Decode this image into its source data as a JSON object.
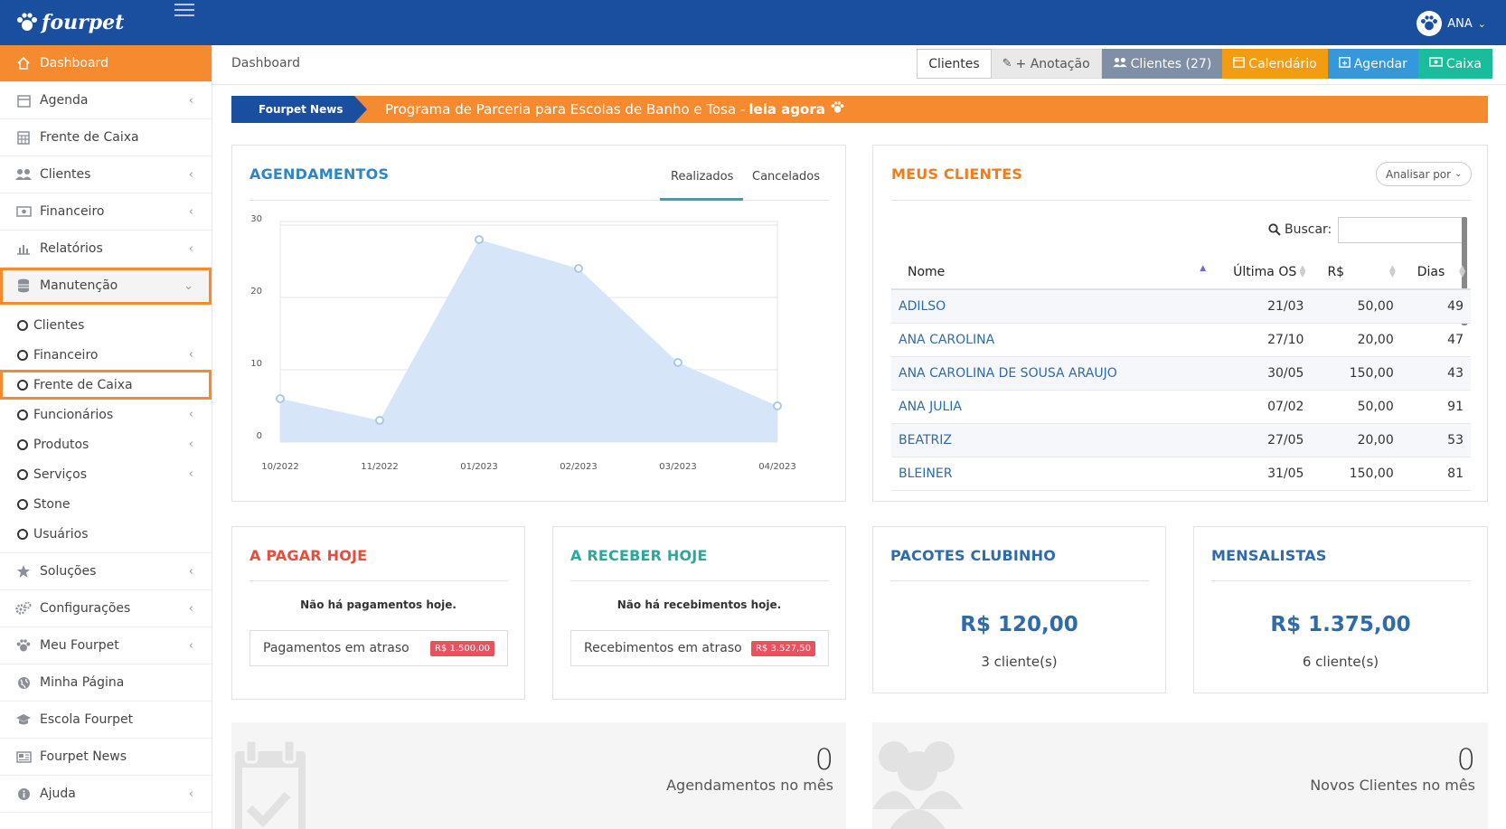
{
  "app": {
    "logo_text": "fourpet",
    "user_name": "ANA"
  },
  "sidebar": {
    "items": [
      {
        "label": "Dashboard",
        "icon": "home-icon"
      },
      {
        "label": "Agenda",
        "icon": "calendar-icon"
      },
      {
        "label": "Frente de Caixa",
        "icon": "calculator-icon"
      },
      {
        "label": "Clientes",
        "icon": "users-icon"
      },
      {
        "label": "Financeiro",
        "icon": "money-icon"
      },
      {
        "label": "Relatórios",
        "icon": "bar-chart-icon"
      },
      {
        "label": "Manutenção",
        "icon": "database-icon"
      }
    ],
    "sub_items": [
      {
        "label": "Clientes"
      },
      {
        "label": "Financeiro"
      },
      {
        "label": "Frente de Caixa"
      },
      {
        "label": "Funcionários"
      },
      {
        "label": "Produtos"
      },
      {
        "label": "Serviços"
      },
      {
        "label": "Stone"
      },
      {
        "label": "Usuários"
      }
    ],
    "items_after": [
      {
        "label": "Soluções",
        "icon": "star-icon"
      },
      {
        "label": "Configurações",
        "icon": "gears-icon"
      },
      {
        "label": "Meu Fourpet",
        "icon": "paw-icon"
      },
      {
        "label": "Minha Página",
        "icon": "globe-icon"
      },
      {
        "label": "Escola Fourpet",
        "icon": "graduation-cap-icon"
      },
      {
        "label": "Fourpet News",
        "icon": "newspaper-icon"
      },
      {
        "label": "Ajuda",
        "icon": "info-icon"
      }
    ]
  },
  "header": {
    "breadcrumb": "Dashboard",
    "buttons": {
      "clientes": "Clientes",
      "anotacao": "+ Anotação",
      "clientes27": "Clientes (27)",
      "calendario": "Calendário",
      "agendar": "Agendar",
      "caixa": "Caixa"
    }
  },
  "news": {
    "label": "Fourpet News",
    "text": "Programa de Parceria para Escolas de Banho e Tosa -",
    "link": "leia agora"
  },
  "agendamentos": {
    "title": "AGENDAMENTOS",
    "tab_active": "Realizados",
    "tab_other": "Cancelados"
  },
  "chart_data": {
    "type": "area",
    "x": [
      "10/2022",
      "11/2022",
      "01/2023",
      "02/2023",
      "03/2023",
      "04/2023"
    ],
    "series": [
      {
        "values": [
          6,
          3,
          28,
          24,
          11,
          5
        ]
      }
    ],
    "ylim": [
      0,
      30
    ],
    "yticks": [
      0,
      10,
      20,
      30
    ],
    "grid": true,
    "color": "#d6e6f8"
  },
  "clientes": {
    "title": "MEUS CLIENTES",
    "analisar": "Analisar por",
    "buscar": "Buscar:",
    "columns": [
      "Nome",
      "Última OS",
      "R$",
      "Dias"
    ],
    "rows": [
      {
        "nome": "ADILSO",
        "os": "21/03",
        "valor": "50,00",
        "dias": "49"
      },
      {
        "nome": "ANA CAROLINA",
        "os": "27/10",
        "valor": "20,00",
        "dias": "47"
      },
      {
        "nome": "ANA CAROLINA DE SOUSA ARAUJO",
        "os": "30/05",
        "valor": "150,00",
        "dias": "43"
      },
      {
        "nome": "ANA JULIA",
        "os": "07/02",
        "valor": "50,00",
        "dias": "91"
      },
      {
        "nome": "BEATRIZ",
        "os": "27/05",
        "valor": "20,00",
        "dias": "53"
      },
      {
        "nome": "BLEINER",
        "os": "31/05",
        "valor": "150,00",
        "dias": "81"
      }
    ]
  },
  "pagar": {
    "title": "A PAGAR HOJE",
    "msg": "Não há pagamentos hoje.",
    "late_label": "Pagamentos em atraso",
    "late_value": "R$ 1.500,00"
  },
  "receber": {
    "title": "A RECEBER HOJE",
    "msg": "Não há recebimentos hoje.",
    "late_label": "Recebimentos em atraso",
    "late_value": "R$ 3.527,50"
  },
  "pacotes": {
    "title": "PACOTES CLUBINHO",
    "value": "R$ 120,00",
    "count": "3 cliente(s)"
  },
  "mensalistas": {
    "title": "MENSALISTAS",
    "value": "R$ 1.375,00",
    "count": "6 cliente(s)"
  },
  "stats": {
    "agend_num": "0",
    "agend_label": "Agendamentos no mês",
    "clientes_num": "0",
    "clientes_label": "Novos Clientes no mês"
  }
}
